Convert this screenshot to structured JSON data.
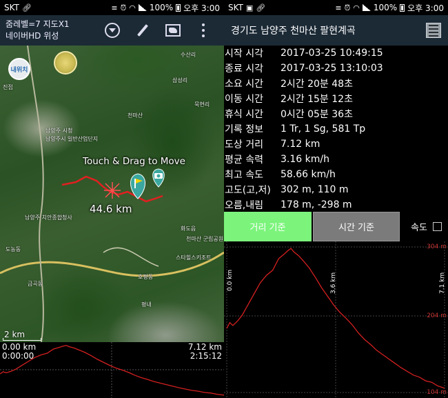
{
  "status_left": {
    "carrier": "SKT",
    "clock": "오후 3:00",
    "battery": "100%"
  },
  "status_right": {
    "carrier": "SKT",
    "clock": "오후 3:00",
    "battery": "100%"
  },
  "map_toolbar": {
    "line1": "줌레벨=7 지도X1",
    "line2": "네이버HD 위성"
  },
  "map": {
    "my_location_label": "내위치",
    "hint_text": "Touch & Drag to Move",
    "distance_label": "44.6 km",
    "scale_label": "2 km",
    "place_labels": [
      "수산리",
      "삼성리",
      "천마산",
      "남양주 시청",
      "평내",
      "스타힐스키조트",
      "호평동",
      "천마산 군립공원",
      "진접",
      "남양주시 일반산업단지",
      "남양주 치안종합청사",
      "도농동",
      "묵현리",
      "화도읍",
      "금곡동"
    ]
  },
  "mini_chart": {
    "start_distance": "0.00 km",
    "start_time": "0:00:00",
    "end_distance": "7.12 km",
    "end_time": "2:15:12"
  },
  "detail": {
    "title": "경기도 남양주 천마산 팔현계곡",
    "stats": [
      {
        "label": "시작 시각",
        "value": "2017-03-25 10:49:15"
      },
      {
        "label": "종료 시각",
        "value": "2017-03-25 13:10:03"
      },
      {
        "label": "소요 시간",
        "value": "2시간 20분 48초"
      },
      {
        "label": "이동 시간",
        "value": "2시간 15분 12초"
      },
      {
        "label": "휴식 시간",
        "value": "0시간 05분 36초"
      },
      {
        "label": "기록 정보",
        "value": "1 Tr, 1 Sg, 581 Tp"
      },
      {
        "label": "도상 거리",
        "value": "7.12 km"
      },
      {
        "label": "평균 속력",
        "value": "3.16 km/h"
      },
      {
        "label": "최고 속도",
        "value": "58.66 km/h"
      },
      {
        "label": "고도(고,저)",
        "value": "302 m, 110 m"
      },
      {
        "label": "오름,내림",
        "value": "178 m, -298 m"
      }
    ],
    "btn_distance": "거리 기준",
    "btn_time": "시간 기준",
    "speed_label": "속도"
  },
  "colors": {
    "accent_green": "#7cf47c",
    "toolbar_bg": "#1c2a36",
    "track_red": "#d42020"
  },
  "chart_data": [
    {
      "type": "line",
      "title": "",
      "xlabel": "",
      "ylabel": "",
      "x_ticks": [
        "0.0 km",
        "3.6 km",
        "7.1 km"
      ],
      "y_ticks": [
        "304 m",
        "204 m",
        "104 m"
      ],
      "ylim": [
        104,
        304
      ],
      "xlim": [
        0,
        7.12
      ],
      "series": [
        {
          "x": [
            0,
            0.1,
            0.2,
            0.35,
            0.5,
            0.7,
            0.9,
            1.1,
            1.3,
            1.5,
            1.7,
            1.9,
            2.0,
            2.1,
            2.2,
            2.35,
            2.5,
            2.7,
            2.9,
            3.1,
            3.3,
            3.5,
            3.7,
            3.9,
            4.1,
            4.3,
            4.5,
            4.7,
            4.9,
            5.1,
            5.3,
            5.5,
            5.7,
            5.9,
            6.1,
            6.3,
            6.5,
            6.7,
            6.9,
            7.12
          ],
          "y": [
            192,
            200,
            196,
            202,
            210,
            225,
            240,
            255,
            265,
            272,
            288,
            295,
            299,
            302,
            297,
            292,
            285,
            275,
            262,
            248,
            236,
            224,
            214,
            206,
            197,
            186,
            177,
            170,
            162,
            156,
            150,
            144,
            138,
            133,
            128,
            125,
            120,
            118,
            113,
            110
          ]
        }
      ]
    }
  ]
}
